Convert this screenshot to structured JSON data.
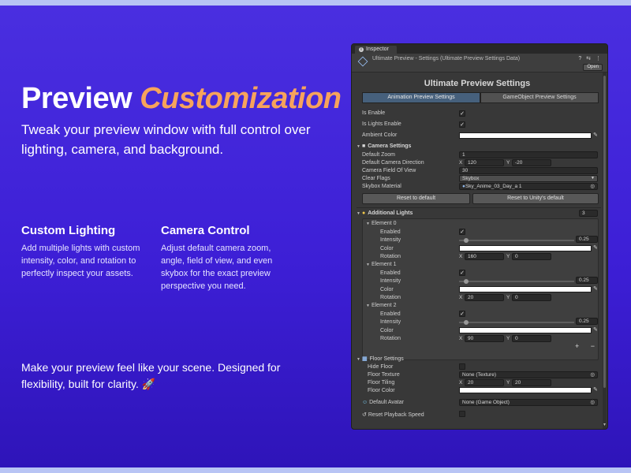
{
  "hero": {
    "title_plain": "Preview",
    "title_accent": "Customization",
    "subtitle": "Tweak your preview window with full control over lighting, camera, and background."
  },
  "features": [
    {
      "title": "Custom Lighting",
      "body": "Add multiple lights with custom intensity, color, and rotation to perfectly inspect your assets."
    },
    {
      "title": "Camera Control",
      "body": "Adjust default camera zoom, angle, field of view, and even skybox for the exact preview perspective you need."
    }
  ],
  "closing": "Make your preview feel like your scene. Designed for flexibility, built for clarity. 🚀",
  "inspector": {
    "tab_label": "Inspector",
    "header_title": "Ultimate Preview - Settings (Ultimate Preview Settings Data)",
    "header_icons": "? ⇆ ⋮",
    "open_label": "Open",
    "panel_title": "Ultimate Preview Settings",
    "tabs": [
      "Animation Preview Settings",
      "GameObject Preview Settings"
    ],
    "is_enable": "Is Enable",
    "is_lights_enable": "Is Lights Enable",
    "ambient_color": "Ambient Color",
    "camera_section": "Camera Settings",
    "default_zoom_label": "Default Zoom",
    "default_zoom_value": "1",
    "default_dir_label": "Default Camera Direction",
    "dir_x": "120",
    "dir_y": "-20",
    "fov_label": "Camera Field Of View",
    "fov_value": "30",
    "clear_flags_label": "Clear Flags",
    "clear_flags_value": "Skybox",
    "skybox_label": "Skybox Material",
    "skybox_value": "Sky_Anime_03_Day_a 1",
    "reset_default": "Reset to default",
    "reset_unity": "Reset to Unity's default",
    "lights_section": "Additional Lights",
    "lights_count": "3",
    "elements": [
      {
        "name": "Element 0",
        "intensity": "0.25",
        "rot_x": "160",
        "rot_y": "0"
      },
      {
        "name": "Element 1",
        "intensity": "0.25",
        "rot_x": "20",
        "rot_y": "0"
      },
      {
        "name": "Element 2",
        "intensity": "0.25",
        "rot_x": "90",
        "rot_y": "0"
      }
    ],
    "el_enabled": "Enabled",
    "el_intensity": "Intensity",
    "el_color": "Color",
    "el_rotation": "Rotation",
    "x_label": "X",
    "y_label": "Y",
    "plus_minus": "+ −",
    "floor_section": "Floor Settings",
    "hide_floor": "Hide Floor",
    "floor_texture": "Floor Texture",
    "floor_texture_value": "None (Texture)",
    "floor_tiling": "Floor Tiling",
    "tiling_x": "20",
    "tiling_y": "20",
    "floor_color": "Floor Color",
    "default_avatar": "Default Avatar",
    "default_avatar_value": "None (Game Object)",
    "reset_playback": "Reset Playback Speed"
  }
}
